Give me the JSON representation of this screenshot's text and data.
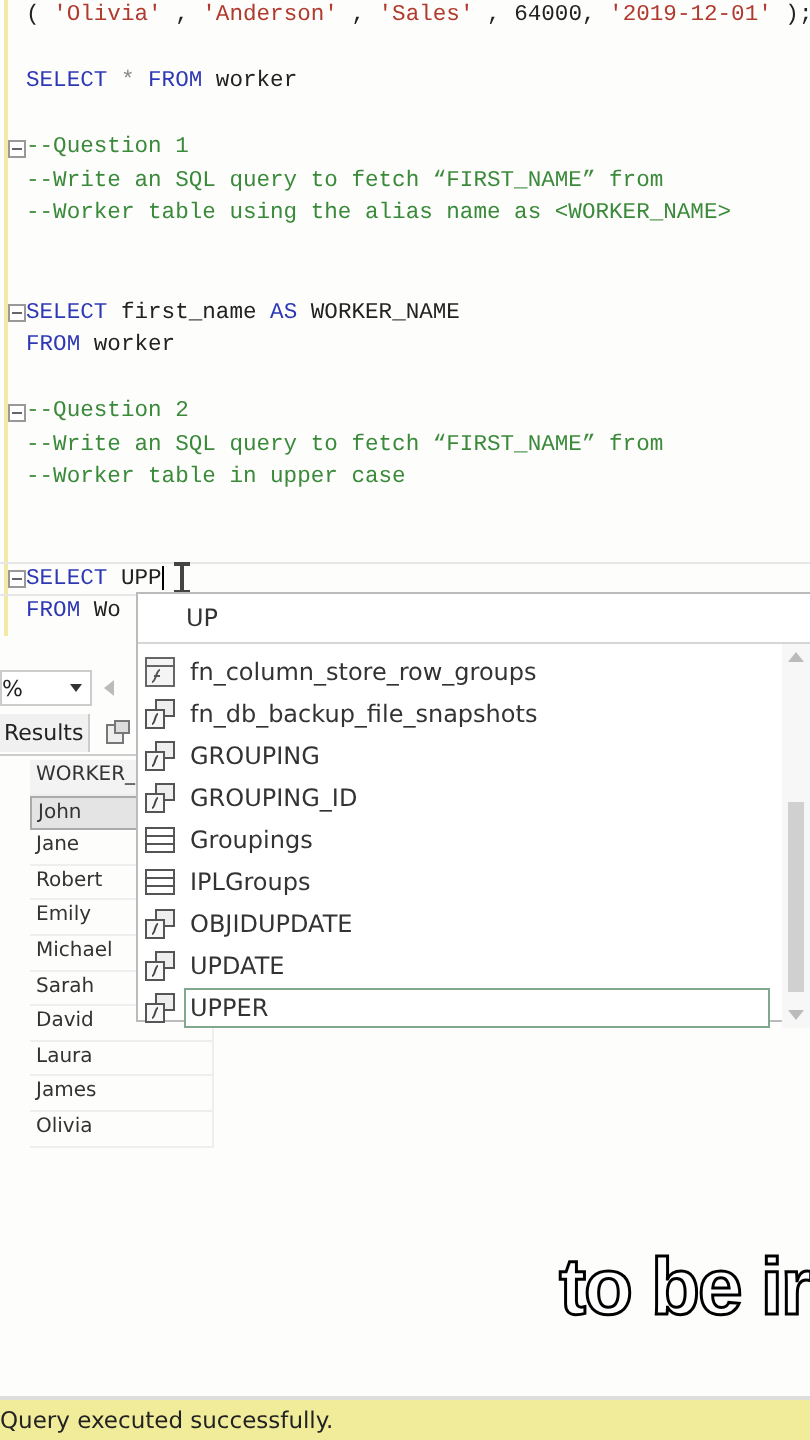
{
  "editor": {
    "lines": [
      {
        "fold": false,
        "tokens": [
          {
            "kind": "plain",
            "text": "( "
          },
          {
            "kind": "string",
            "text": "'Olivia'"
          },
          {
            "kind": "plain",
            "text": " , "
          },
          {
            "kind": "string",
            "text": "'Anderson'"
          },
          {
            "kind": "plain",
            "text": " , "
          },
          {
            "kind": "string",
            "text": "'Sales'"
          },
          {
            "kind": "plain",
            "text": " , 64000, "
          },
          {
            "kind": "string",
            "text": "'2019-12-01'"
          },
          {
            "kind": "plain",
            "text": " );"
          }
        ]
      },
      {
        "fold": false
      },
      {
        "fold": false,
        "tokens": [
          {
            "kind": "keyword",
            "text": "SELECT"
          },
          {
            "kind": "operator",
            "text": " * "
          },
          {
            "kind": "keyword",
            "text": "FROM"
          },
          {
            "kind": "plain",
            "text": " worker"
          }
        ]
      },
      {
        "fold": false
      },
      {
        "fold": true,
        "tokens": [
          {
            "kind": "comment",
            "text": "--Question 1"
          }
        ]
      },
      {
        "fold": false,
        "tokens": [
          {
            "kind": "comment",
            "text": "--Write an SQL query to fetch “FIRST_NAME” from"
          }
        ]
      },
      {
        "fold": false,
        "tokens": [
          {
            "kind": "comment",
            "text": "--Worker table using the alias name as <WORKER_NAME>"
          }
        ]
      },
      {
        "fold": false
      },
      {
        "fold": false
      },
      {
        "fold": true,
        "tokens": [
          {
            "kind": "keyword",
            "text": "SELECT"
          },
          {
            "kind": "plain",
            "text": " first_name "
          },
          {
            "kind": "keyword",
            "text": "AS"
          },
          {
            "kind": "plain",
            "text": " WORKER_NAME"
          }
        ]
      },
      {
        "fold": false,
        "tokens": [
          {
            "kind": "keyword",
            "text": "FROM"
          },
          {
            "kind": "plain",
            "text": " worker"
          }
        ]
      },
      {
        "fold": false
      },
      {
        "fold": true,
        "tokens": [
          {
            "kind": "comment",
            "text": "--Question 2"
          }
        ]
      },
      {
        "fold": false,
        "tokens": [
          {
            "kind": "comment",
            "text": "--Write an SQL query to fetch “FIRST_NAME” from"
          }
        ]
      },
      {
        "fold": false,
        "tokens": [
          {
            "kind": "comment",
            "text": "--Worker table in upper case"
          }
        ]
      },
      {
        "fold": false
      },
      {
        "fold": false
      },
      {
        "fold": true,
        "current": true,
        "tokens": [
          {
            "kind": "keyword",
            "text": "SELECT"
          },
          {
            "kind": "plain",
            "text": " UPP"
          }
        ]
      },
      {
        "fold": false,
        "tokens": [
          {
            "kind": "keyword",
            "text": "FROM"
          },
          {
            "kind": "plain",
            "text": " Wo"
          }
        ]
      }
    ]
  },
  "autocomplete": {
    "filter": "UP",
    "items": [
      {
        "kind": "function",
        "label": "fn_column_store_row_groups",
        "selected": false
      },
      {
        "kind": "builtin",
        "label": "fn_db_backup_file_snapshots",
        "selected": false
      },
      {
        "kind": "builtin",
        "label": "GROUPING",
        "selected": false
      },
      {
        "kind": "builtin",
        "label": "GROUPING_ID",
        "selected": false
      },
      {
        "kind": "table",
        "label": "Groupings",
        "selected": false
      },
      {
        "kind": "table",
        "label": "IPLGroups",
        "selected": false
      },
      {
        "kind": "builtin",
        "label": "OBJIDUPDATE",
        "selected": false
      },
      {
        "kind": "builtin",
        "label": "UPDATE",
        "selected": false
      },
      {
        "kind": "builtin",
        "label": "UPPER",
        "selected": true
      }
    ]
  },
  "zoom": "%",
  "results_tab": "Results",
  "grid": {
    "column": "WORKER_",
    "rows": [
      {
        "value": "John",
        "selected": true
      },
      {
        "value": "Jane",
        "selected": false
      },
      {
        "value": "Robert",
        "selected": false
      },
      {
        "value": "Emily",
        "selected": false
      },
      {
        "value": "Michael",
        "selected": false
      },
      {
        "value": "Sarah",
        "selected": false
      },
      {
        "value": "David",
        "selected": false
      },
      {
        "value": "Laura",
        "selected": false
      },
      {
        "value": "James",
        "selected": false
      },
      {
        "value": "Olivia",
        "selected": false
      }
    ]
  },
  "caption": "to be ir",
  "status_bar": "Query executed successfully."
}
